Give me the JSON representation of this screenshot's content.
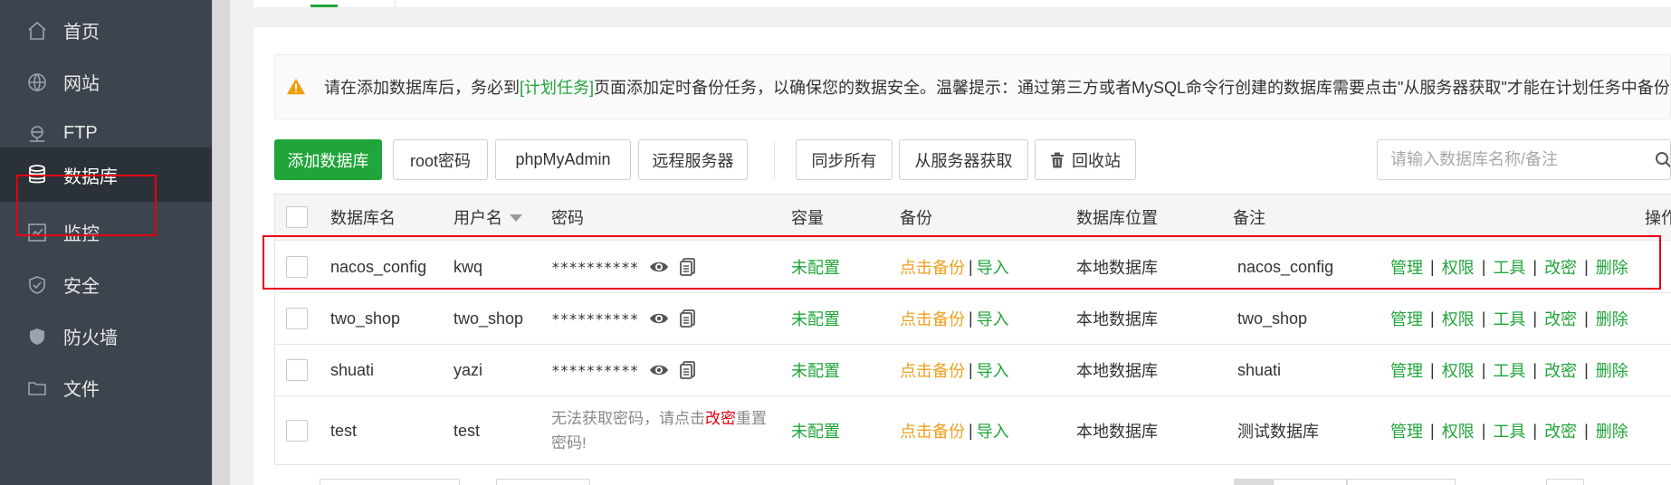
{
  "sidebar": {
    "items": [
      {
        "label": "首页",
        "icon": "home-icon"
      },
      {
        "label": "网站",
        "icon": "globe-icon"
      },
      {
        "label": "FTP",
        "icon": "ftp-icon"
      },
      {
        "label": "数据库",
        "icon": "database-icon",
        "active": true
      },
      {
        "label": "监控",
        "icon": "monitor-icon"
      },
      {
        "label": "安全",
        "icon": "shield-icon"
      },
      {
        "label": "防火墙",
        "icon": "firewall-icon"
      },
      {
        "label": "文件",
        "icon": "folder-icon"
      }
    ]
  },
  "alert": {
    "prefix": "请在添加数据库后，务必到",
    "link": "[计划任务]",
    "suffix": "页面添加定时备份任务，以确保您的数据安全。温馨提示：通过第三方或者MySQL命令行创建的数据库需要点击\"从服务器获取\"才能在计划任务中备份"
  },
  "toolbar": {
    "add_db": "添加数据库",
    "root_pw": "root密码",
    "phpmyadmin": "phpMyAdmin",
    "remote": "远程服务器",
    "sync_all": "同步所有",
    "fetch_server": "从服务器获取",
    "recycle": "回收站",
    "search_placeholder": "请输入数据库名称/备注"
  },
  "table": {
    "headers": {
      "name": "数据库名",
      "user": "用户名",
      "password": "密码",
      "capacity": "容量",
      "backup": "备份",
      "location": "数据库位置",
      "note": "备注",
      "ops": "操作"
    },
    "rows": [
      {
        "name": "nacos_config",
        "user": "kwq",
        "password": "**********",
        "capacity": "未配置",
        "backup": "点击备份",
        "import": "导入",
        "location": "本地数据库",
        "note": "nacos_config"
      },
      {
        "name": "two_shop",
        "user": "two_shop",
        "password": "**********",
        "capacity": "未配置",
        "backup": "点击备份",
        "import": "导入",
        "location": "本地数据库",
        "note": "two_shop"
      },
      {
        "name": "shuati",
        "user": "yazi",
        "password": "**********",
        "capacity": "未配置",
        "backup": "点击备份",
        "import": "导入",
        "location": "本地数据库",
        "note": "shuati"
      },
      {
        "name": "test",
        "user": "test",
        "pw_fail_a": "无法获取密码，请点击",
        "pw_fail_link": "改密",
        "pw_fail_b": "重置密码!",
        "capacity": "未配置",
        "backup": "点击备份",
        "import": "导入",
        "location": "本地数据库",
        "note": "测试数据库"
      }
    ],
    "ops": {
      "manage": "管理",
      "perm": "权限",
      "tools": "工具",
      "chpw": "改密",
      "delete": "删除"
    },
    "separator": "|"
  },
  "colors": {
    "accent": "#20a53a",
    "sidebar_bg": "#3c444d",
    "highlight_red": "#e60012",
    "backup_orange": "#f0a020"
  }
}
